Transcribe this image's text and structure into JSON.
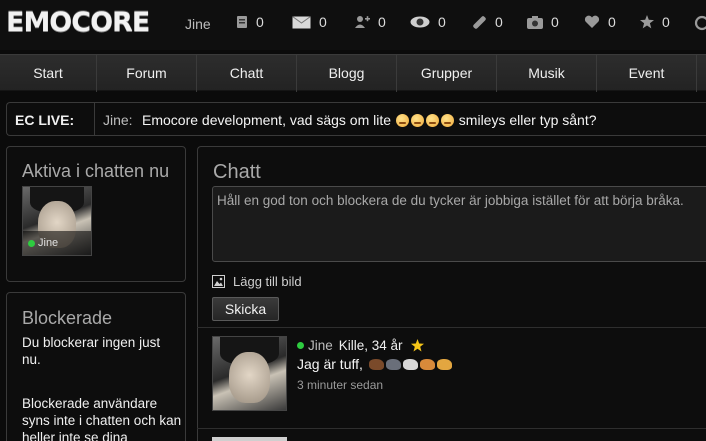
{
  "header": {
    "logo": "EMOCORE",
    "username": "Jine",
    "stats": [
      {
        "icon": "guestbook-icon",
        "count": "0"
      },
      {
        "icon": "mail-icon",
        "count": "0"
      },
      {
        "icon": "add-friend-icon",
        "count": "0"
      },
      {
        "icon": "eye-icon",
        "count": "0"
      },
      {
        "icon": "bandage-icon",
        "count": "0"
      },
      {
        "icon": "camera-icon",
        "count": "0"
      },
      {
        "icon": "heart-icon",
        "count": "0"
      },
      {
        "icon": "star-icon",
        "count": "0"
      }
    ]
  },
  "nav": {
    "items": [
      "Start",
      "Forum",
      "Chatt",
      "Blogg",
      "Grupper",
      "Musik",
      "Event"
    ]
  },
  "live": {
    "label": "EC LIVE:",
    "user": "Jine:",
    "message_start": "Emocore development, vad sägs om lite",
    "message_end": "smileys eller typ sånt?"
  },
  "active_panel": {
    "title": "Aktiva i chatten nu",
    "users": [
      {
        "name": "Jine",
        "online": true
      }
    ]
  },
  "blocked_panel": {
    "title": "Blockerade",
    "text1": "Du blockerar ingen just nu.",
    "text2": "Blockerade användare syns inte i chatten och kan heller inte se dina"
  },
  "chat": {
    "title": "Chatt",
    "input_placeholder": "Håll en god ton och blockera de du tycker är jobbiga istället för att börja bråka.",
    "add_image_label": "Lägg till bild",
    "send_label": "Skicka",
    "messages": [
      {
        "user": "Jine",
        "info": "Kille, 34 år",
        "text": "Jag är tuff,",
        "time": "3 minuter sedan"
      }
    ]
  },
  "colors": {
    "online": "#2ecc40",
    "star": "#f5c518",
    "background": "#0b0b0b"
  }
}
